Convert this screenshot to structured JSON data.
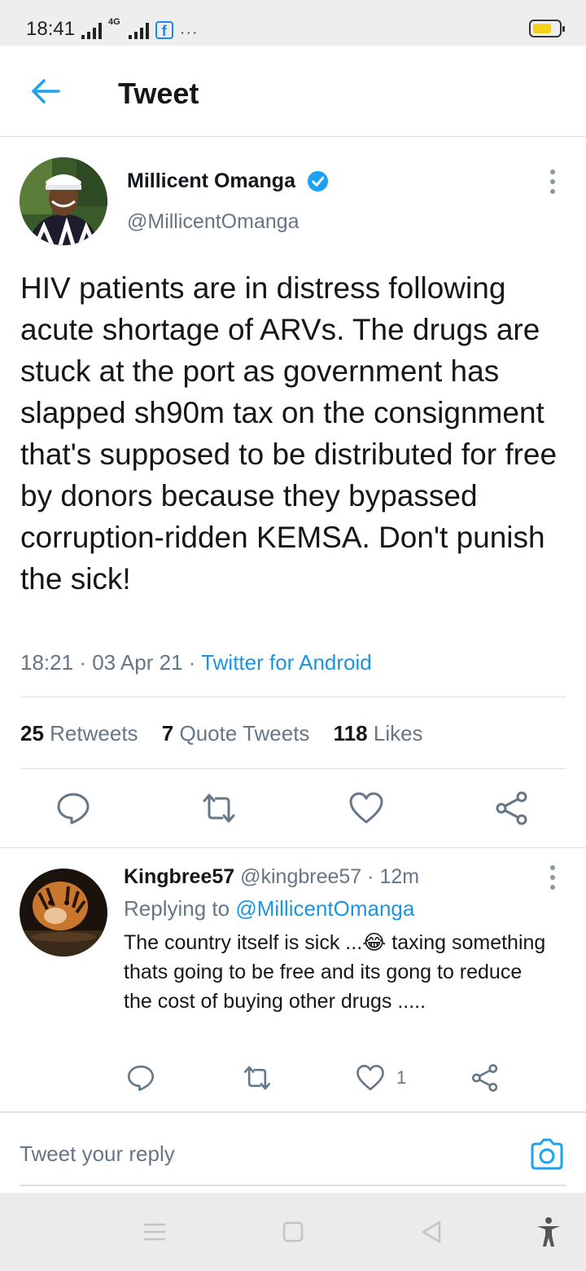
{
  "status_bar": {
    "time": "18:41",
    "network_label": "4G",
    "facebook_glyph": "f",
    "more_dots": "···",
    "battery_color": "#f7d117"
  },
  "header": {
    "title": "Tweet",
    "back_icon": "arrow-left-icon",
    "accent_color": "#1da1f2"
  },
  "tweet": {
    "author_name": "Millicent Omanga",
    "handle": "@MillicentOmanga",
    "verified": true,
    "text": "HIV patients are in distress following acute shortage of ARVs. The drugs are stuck at the port as government has slapped sh90m tax on the consignment that's supposed to be distributed for free by donors because they bypassed corruption-ridden KEMSA. Don't punish the sick!",
    "time": "18:21",
    "date": "03 Apr 21",
    "separator": "·",
    "source": "Twitter for Android",
    "stats": {
      "retweets_count": "25",
      "retweets_label": "Retweets",
      "quotes_count": "7",
      "quotes_label": "Quote Tweets",
      "likes_count": "118",
      "likes_label": "Likes"
    }
  },
  "reply": {
    "author_name": "Kingbree57",
    "handle": "@kingbree57",
    "separator": "·",
    "age": "12m",
    "replying_label": "Replying to",
    "replying_to": "@MillicentOmanga",
    "text_before_emoji": "The country itself is sick ...",
    "emoji": "😂",
    "text_after_emoji": " taxing something thats going to be free and its gong to reduce the cost of buying other drugs .....",
    "like_count": "1"
  },
  "compose": {
    "placeholder": "Tweet your reply",
    "camera_icon": "camera-icon"
  },
  "nav_bar": {
    "buttons": [
      "menu-icon",
      "home-square-icon",
      "back-triangle-icon",
      "accessibility-icon"
    ]
  }
}
